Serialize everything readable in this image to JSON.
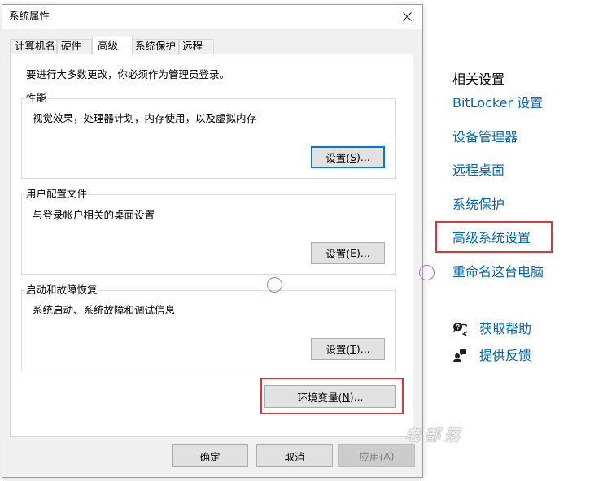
{
  "dialog": {
    "title": "系统属性",
    "close_icon": "close-icon",
    "tabs": [
      {
        "label": "计算机名",
        "selected": false
      },
      {
        "label": "硬件",
        "selected": false
      },
      {
        "label": "高级",
        "selected": true
      },
      {
        "label": "系统保护",
        "selected": false
      },
      {
        "label": "远程",
        "selected": false
      }
    ],
    "admin_notice": "要进行大多数更改，你必须作为管理员登录。",
    "groups": [
      {
        "title": "性能",
        "description": "视觉效果，处理器计划，内存使用，以及虚拟内存",
        "button_label": "设置(S)...",
        "button_focused": true
      },
      {
        "title": "用户配置文件",
        "description": "与登录帐户相关的桌面设置",
        "button_label": "设置(E)...",
        "button_focused": false
      },
      {
        "title": "启动和故障恢复",
        "description": "系统启动、系统故障和调试信息",
        "button_label": "设置(T)...",
        "button_focused": false
      }
    ],
    "environment_button_label": "环境变量(N)...",
    "environment_button_highlighted": true,
    "footer": {
      "ok_label": "确定",
      "cancel_label": "取消",
      "apply_label": "应用(A)",
      "apply_enabled": false
    }
  },
  "related_settings": {
    "heading": "相关设置",
    "links": [
      {
        "label": "BitLocker 设置",
        "highlighted": false
      },
      {
        "label": "设备管理器",
        "highlighted": false
      },
      {
        "label": "远程桌面",
        "highlighted": false
      },
      {
        "label": "系统保护",
        "highlighted": false
      },
      {
        "label": "高级系统设置",
        "highlighted": true
      },
      {
        "label": "重命名这台电脑",
        "highlighted": false
      }
    ]
  },
  "support": [
    {
      "icon": "get-help-icon",
      "label": "获取帮助"
    },
    {
      "icon": "give-feedback-icon",
      "label": "提供反馈"
    }
  ],
  "watermark": "老部落",
  "annotations": {
    "highlight_color": "#e53238",
    "click_indicator_color": "#a86fd6"
  },
  "colors": {
    "link": "#0067b8",
    "focus_accent": "#0078d7",
    "disabled_text": "#838383"
  }
}
